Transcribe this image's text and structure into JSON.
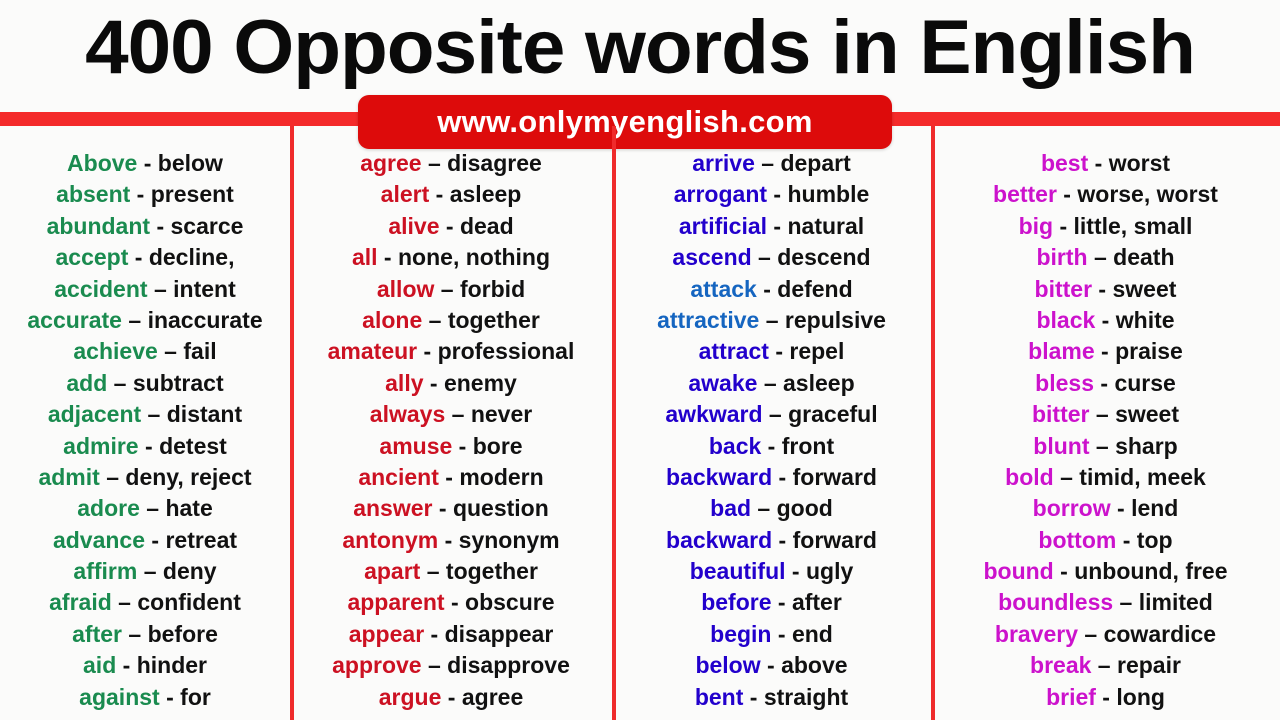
{
  "header": {
    "title": "400 Opposite words in English",
    "badge_text": "www.onlymyenglish.com",
    "rule_color": "#f42a2a",
    "badge_color": "#dd0b0b",
    "title_color": "#0a0a0a"
  },
  "palette": {
    "column1_head": "#1a8b4f",
    "column2_head": "#cc1122",
    "column3_head": "#2200cc",
    "column3_head_alt": "#1565c0",
    "column4_head": "#cc12cc",
    "antonym": "#111111",
    "divider": "#ef2b2b",
    "background": "#fbfbfa"
  },
  "columns": [
    {
      "name": "column-1",
      "head_color": "#1a8b4f",
      "rows": [
        {
          "head": "Above",
          "sep": " - ",
          "antonym": "below"
        },
        {
          "head": "absent",
          "sep": " - ",
          "antonym": "present"
        },
        {
          "head": "abundant",
          "sep": " - ",
          "antonym": "scarce"
        },
        {
          "head": "accept",
          "sep": " - ",
          "antonym": "decline,"
        },
        {
          "head": "accident",
          "sep": " – ",
          "antonym": "intent"
        },
        {
          "head": "accurate",
          "sep": " – ",
          "antonym": "inaccurate"
        },
        {
          "head": "achieve",
          "sep": " – ",
          "antonym": "fail"
        },
        {
          "head": "add",
          "sep": " – ",
          "antonym": "subtract"
        },
        {
          "head": "adjacent",
          "sep": " – ",
          "antonym": "distant"
        },
        {
          "head": "admire",
          "sep": " - ",
          "antonym": "detest"
        },
        {
          "head": "admit",
          "sep": " – ",
          "antonym": "deny, reject"
        },
        {
          "head": "adore",
          "sep": " – ",
          "antonym": "hate"
        },
        {
          "head": "advance",
          "sep": " - ",
          "antonym": "retreat"
        },
        {
          "head": "affirm",
          "sep": " – ",
          "antonym": "deny"
        },
        {
          "head": "afraid",
          "sep": " – ",
          "antonym": "confident"
        },
        {
          "head": "after",
          "sep": " – ",
          "antonym": "before"
        },
        {
          "head": "aid",
          "sep": " - ",
          "antonym": "hinder"
        },
        {
          "head": "against",
          "sep": " - ",
          "antonym": "for"
        }
      ]
    },
    {
      "name": "column-2",
      "head_color": "#cc1122",
      "rows": [
        {
          "head": "agree",
          "sep": " – ",
          "antonym": "disagree"
        },
        {
          "head": "alert",
          "sep": " - ",
          "antonym": "asleep"
        },
        {
          "head": "alive",
          "sep": " - ",
          "antonym": "dead"
        },
        {
          "head": "all",
          "sep": " - ",
          "antonym": "none, nothing"
        },
        {
          "head": "allow",
          "sep": " – ",
          "antonym": "forbid"
        },
        {
          "head": "alone",
          "sep": " – ",
          "antonym": "together"
        },
        {
          "head": "amateur",
          "sep": " - ",
          "antonym": "professional"
        },
        {
          "head": "ally",
          "sep": " - ",
          "antonym": "enemy"
        },
        {
          "head": "always",
          "sep": " – ",
          "antonym": "never"
        },
        {
          "head": "amuse",
          "sep": " - ",
          "antonym": "bore"
        },
        {
          "head": "ancient",
          "sep": " - ",
          "antonym": "modern"
        },
        {
          "head": "answer",
          "sep": " - ",
          "antonym": "question"
        },
        {
          "head": "antonym",
          "sep": " - ",
          "antonym": "synonym"
        },
        {
          "head": "apart",
          "sep": " – ",
          "antonym": "together"
        },
        {
          "head": "apparent",
          "sep": " - ",
          "antonym": "obscure"
        },
        {
          "head": "appear",
          "sep": " - ",
          "antonym": "disappear"
        },
        {
          "head": "approve",
          "sep": " – ",
          "antonym": "disapprove"
        },
        {
          "head": "argue",
          "sep": " - ",
          "antonym": "agree"
        }
      ]
    },
    {
      "name": "column-3",
      "head_color": "#2200cc",
      "rows": [
        {
          "head": "arrive",
          "sep": " – ",
          "antonym": "depart"
        },
        {
          "head": "arrogant",
          "sep": " - ",
          "antonym": "humble"
        },
        {
          "head": "artificial",
          "sep": " - ",
          "antonym": "natural"
        },
        {
          "head": "ascend",
          "sep": " – ",
          "antonym": "descend"
        },
        {
          "head": "attack",
          "sep": " - ",
          "antonym": "defend",
          "head_color": "#1565c0"
        },
        {
          "head": "attractive",
          "sep": " – ",
          "antonym": "repulsive",
          "head_color": "#1565c0"
        },
        {
          "head": "attract",
          "sep": " - ",
          "antonym": "repel"
        },
        {
          "head": "awake",
          "sep": " – ",
          "antonym": "asleep"
        },
        {
          "head": "awkward",
          "sep": " – ",
          "antonym": "graceful"
        },
        {
          "head": "back",
          "sep": " - ",
          "antonym": "front"
        },
        {
          "head": "backward",
          "sep": " - ",
          "antonym": "forward"
        },
        {
          "head": "bad",
          "sep": " – ",
          "antonym": "good"
        },
        {
          "head": "backward",
          "sep": " - ",
          "antonym": "forward"
        },
        {
          "head": "beautiful",
          "sep": " - ",
          "antonym": "ugly"
        },
        {
          "head": "before",
          "sep": " - ",
          "antonym": "after"
        },
        {
          "head": "begin",
          "sep": " - ",
          "antonym": "end"
        },
        {
          "head": "below",
          "sep": " - ",
          "antonym": "above"
        },
        {
          "head": "bent",
          "sep": " - ",
          "antonym": "straight"
        }
      ]
    },
    {
      "name": "column-4",
      "head_color": "#cc12cc",
      "rows": [
        {
          "head": "best",
          "sep": " - ",
          "antonym": "worst"
        },
        {
          "head": "better",
          "sep": " - ",
          "antonym": "worse, worst"
        },
        {
          "head": "big",
          "sep": " - ",
          "antonym": "little, small"
        },
        {
          "head": "birth",
          "sep": " – ",
          "antonym": "death"
        },
        {
          "head": "bitter",
          "sep": " - ",
          "antonym": "sweet"
        },
        {
          "head": "black",
          "sep": " - ",
          "antonym": "white"
        },
        {
          "head": "blame",
          "sep": " - ",
          "antonym": "praise"
        },
        {
          "head": "bless",
          "sep": " - ",
          "antonym": "curse"
        },
        {
          "head": "bitter",
          "sep": " – ",
          "antonym": "sweet"
        },
        {
          "head": "blunt",
          "sep": " – ",
          "antonym": "sharp"
        },
        {
          "head": "bold",
          "sep": " – ",
          "antonym": "timid, meek"
        },
        {
          "head": "borrow",
          "sep": " - ",
          "antonym": "lend"
        },
        {
          "head": "bottom",
          "sep": " - ",
          "antonym": "top"
        },
        {
          "head": "bound",
          "sep": " - ",
          "antonym": "unbound, free"
        },
        {
          "head": "boundless",
          "sep": " – ",
          "antonym": "limited"
        },
        {
          "head": "bravery",
          "sep": " – ",
          "antonym": "cowardice"
        },
        {
          "head": "break",
          "sep": " – ",
          "antonym": "repair"
        },
        {
          "head": "brief",
          "sep": " - ",
          "antonym": "long"
        }
      ]
    }
  ]
}
